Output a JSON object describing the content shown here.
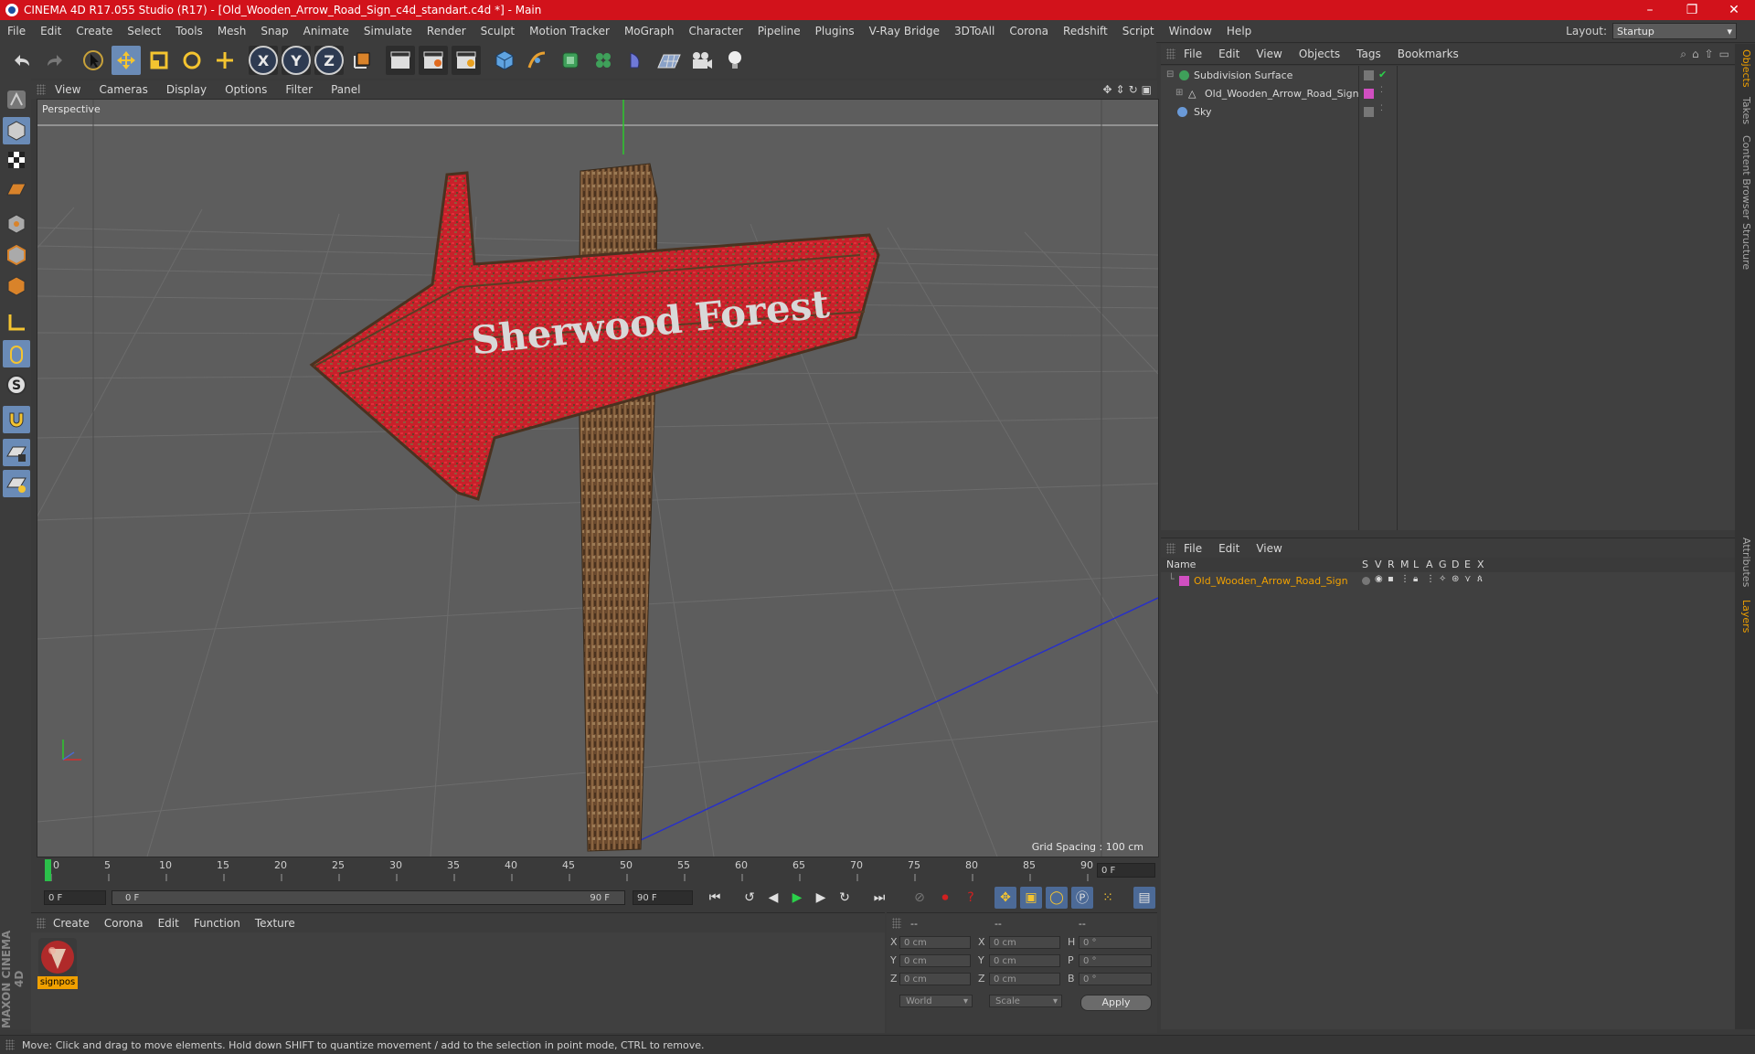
{
  "window": {
    "title": "CINEMA 4D R17.055 Studio (R17) - [Old_Wooden_Arrow_Road_Sign_c4d_standart.c4d *] - Main",
    "minimize": "–",
    "restore": "❐",
    "close": "✕"
  },
  "menubar": {
    "items": [
      "File",
      "Edit",
      "Create",
      "Select",
      "Tools",
      "Mesh",
      "Snap",
      "Animate",
      "Simulate",
      "Render",
      "Sculpt",
      "Motion Tracker",
      "MoGraph",
      "Character",
      "Pipeline",
      "Plugins",
      "V-Ray Bridge",
      "3DToAll",
      "Corona",
      "Redshift",
      "Script",
      "Window",
      "Help"
    ],
    "layout_label": "Layout:",
    "layout_value": "Startup"
  },
  "toolbar": {
    "axis_x": "X",
    "axis_y": "Y",
    "axis_z": "Z"
  },
  "viewport": {
    "menu": [
      "View",
      "Cameras",
      "Display",
      "Options",
      "Filter",
      "Panel"
    ],
    "label": "Perspective",
    "grid_spacing": "Grid Spacing : 100 cm",
    "sign_text": "Sherwood Forest"
  },
  "timeline": {
    "ticks": [
      "0",
      "5",
      "10",
      "15",
      "20",
      "25",
      "30",
      "35",
      "40",
      "45",
      "50",
      "55",
      "60",
      "65",
      "70",
      "75",
      "80",
      "85",
      "90"
    ],
    "current_frame": "0 F",
    "start_field": "0 F",
    "range_start": "0 F",
    "range_end": "90 F",
    "end_field": "90 F"
  },
  "material_manager": {
    "menu": [
      "Create",
      "Corona",
      "Edit",
      "Function",
      "Texture"
    ],
    "material_name": "signpos"
  },
  "coordinates": {
    "header_a": "--",
    "header_b": "--",
    "header_c": "--",
    "pos_labels": [
      "X",
      "Y",
      "Z"
    ],
    "pos_values": [
      "0 cm",
      "0 cm",
      "0 cm"
    ],
    "size_labels": [
      "X",
      "Y",
      "Z"
    ],
    "size_values": [
      "0 cm",
      "0 cm",
      "0 cm"
    ],
    "rot_labels": [
      "H",
      "P",
      "B"
    ],
    "rot_values": [
      "0 °",
      "0 °",
      "0 °"
    ],
    "mode_world": "World",
    "mode_scale": "Scale",
    "apply": "Apply"
  },
  "object_manager": {
    "menu": [
      "File",
      "Edit",
      "View",
      "Objects",
      "Tags",
      "Bookmarks"
    ],
    "objects": [
      {
        "name": "Subdivision Surface"
      },
      {
        "name": "Old_Wooden_Arrow_Road_Sign"
      },
      {
        "name": "Sky"
      }
    ]
  },
  "layer_manager": {
    "menu": [
      "File",
      "Edit",
      "View"
    ],
    "col_name": "Name",
    "col_flags": [
      "S",
      "V",
      "R",
      "M",
      "L",
      "A",
      "G",
      "D",
      "E",
      "X"
    ],
    "layers": [
      {
        "name": "Old_Wooden_Arrow_Road_Sign"
      }
    ]
  },
  "side_tabs": [
    "Objects",
    "Takes",
    "Content Browser",
    "Structure",
    "Attributes",
    "Layers"
  ],
  "status": {
    "text": "Move: Click and drag to move elements. Hold down SHIFT to quantize movement / add to the selection in point mode, CTRL to remove."
  },
  "branding": {
    "logo_text": "MAXON CINEMA 4D"
  },
  "colors": {
    "title_red": "#d2121b",
    "selection_blue": "#6a8bb7",
    "layer_orange": "#f0a000",
    "viewport_bg": "#5d5d5d"
  }
}
